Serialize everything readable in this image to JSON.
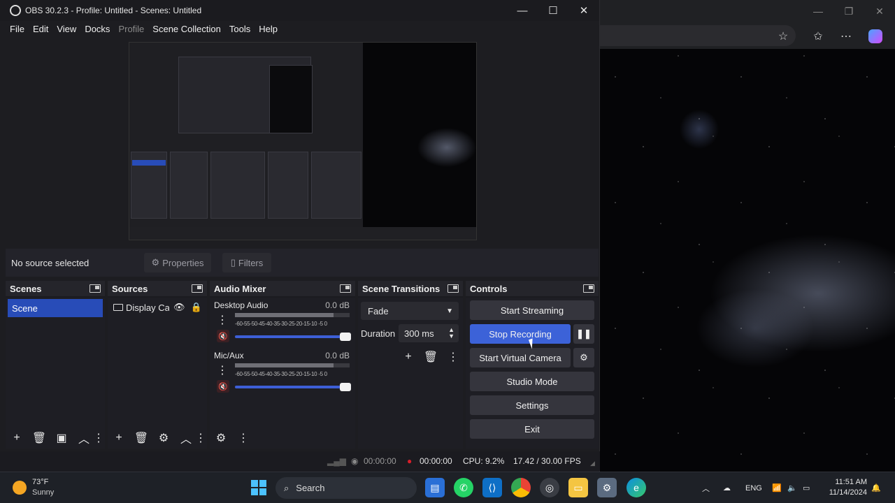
{
  "window": {
    "title": "OBS 30.2.3 - Profile: Untitled - Scenes: Untitled",
    "controls": {
      "minimize": "—",
      "maximize": "☐",
      "close": "✕"
    }
  },
  "menu": [
    "File",
    "Edit",
    "View",
    "Docks",
    "Profile",
    "Scene Collection",
    "Tools",
    "Help"
  ],
  "source_bar": {
    "no_source": "No source selected",
    "properties": "Properties",
    "filters": "Filters"
  },
  "docks": {
    "scenes": {
      "title": "Scenes",
      "items": [
        "Scene"
      ]
    },
    "sources": {
      "title": "Sources",
      "items": [
        "Display Ca"
      ]
    },
    "audio_mixer": {
      "title": "Audio Mixer",
      "channels": [
        {
          "name": "Desktop Audio",
          "db": "0.0 dB"
        },
        {
          "name": "Mic/Aux",
          "db": "0.0 dB"
        }
      ],
      "scale": "-60-55-50-45-40-35-30-25-20-15-10 -5  0"
    },
    "transitions": {
      "title": "Scene Transitions",
      "type": "Fade",
      "duration_label": "Duration",
      "duration_value": "300 ms"
    },
    "controls": {
      "title": "Controls",
      "buttons": [
        "Start Streaming",
        "Stop Recording",
        "Start Virtual Camera",
        "Studio Mode",
        "Settings",
        "Exit"
      ]
    }
  },
  "status": {
    "stream_time": "00:00:00",
    "rec_time": "00:00:00",
    "cpu": "CPU: 9.2%",
    "fps": "17.42 / 30.00 FPS"
  },
  "taskbar": {
    "weather_temp": "73°F",
    "weather_desc": "Sunny",
    "search": "Search",
    "lang": "ENG",
    "time": "11:51 AM",
    "date": "11/14/2024"
  },
  "colors": {
    "accent": "#3c62d8",
    "scene_selected": "#284cb8",
    "record_dot": "#d81e2a"
  }
}
